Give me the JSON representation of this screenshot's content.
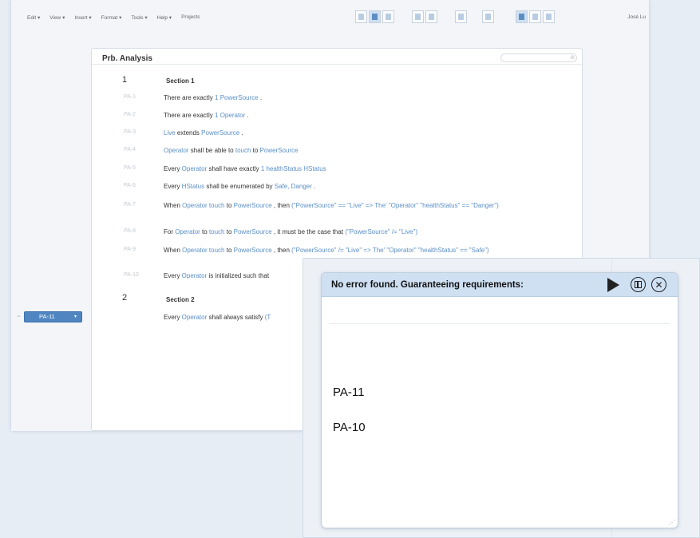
{
  "menu": [
    "Edit",
    "View",
    "Insert",
    "Format",
    "Tools",
    "Help",
    "Projects"
  ],
  "user": "José Lu",
  "doc": {
    "title": "Prb. Analysis",
    "sections": [
      {
        "number": "1",
        "title": "Section 1"
      },
      {
        "number": "2",
        "title": "Section 2"
      }
    ],
    "requirements": [
      {
        "id": "PA-1",
        "segments": [
          [
            "There are exactly ",
            false
          ],
          [
            "1 PowerSource",
            true
          ],
          [
            " .",
            false
          ]
        ]
      },
      {
        "id": "PA-2",
        "segments": [
          [
            "There are exactly ",
            false
          ],
          [
            "1 Operator",
            true
          ],
          [
            " .",
            false
          ]
        ]
      },
      {
        "id": "PA-3",
        "segments": [
          [
            "Live",
            true
          ],
          [
            " extends ",
            false
          ],
          [
            "PowerSource",
            true
          ],
          [
            " .",
            false
          ]
        ]
      },
      {
        "id": "PA-4",
        "segments": [
          [
            "Operator",
            true
          ],
          [
            " shall be able to ",
            false
          ],
          [
            "touch",
            true
          ],
          [
            " to ",
            false
          ],
          [
            "PowerSource",
            true
          ]
        ]
      },
      {
        "id": "PA-5",
        "segments": [
          [
            "Every ",
            false
          ],
          [
            "Operator",
            true
          ],
          [
            " shall have exactly ",
            false
          ],
          [
            "1 healthStatus HStatus",
            true
          ]
        ]
      },
      {
        "id": "PA-6",
        "segments": [
          [
            "Every ",
            false
          ],
          [
            "HStatus",
            true
          ],
          [
            " shall be enumerated by ",
            false
          ],
          [
            "Safe, Danger",
            true
          ],
          [
            " .",
            false
          ]
        ]
      },
      {
        "id": "PA-7",
        "segments": [
          [
            "When ",
            false
          ],
          [
            "Operator touch",
            true
          ],
          [
            " to ",
            false
          ],
          [
            "PowerSource",
            true
          ],
          [
            " , then ",
            false
          ],
          [
            "(\"PowerSource\" == \"Live\" => The' \"Operator\" \"healthStatus\" == \"Danger\")",
            true
          ]
        ]
      },
      {
        "id": "PA-8",
        "segments": [
          [
            "For ",
            false
          ],
          [
            "Operator",
            true
          ],
          [
            " to ",
            false
          ],
          [
            "touch",
            true
          ],
          [
            " to ",
            false
          ],
          [
            "PowerSource",
            true
          ],
          [
            " , it must be the case that ",
            false
          ],
          [
            "(\"PowerSource\" /= \"Live\")",
            true
          ]
        ]
      },
      {
        "id": "PA-9",
        "segments": [
          [
            "When ",
            false
          ],
          [
            "Operator touch",
            true
          ],
          [
            " to ",
            false
          ],
          [
            "PowerSource",
            true
          ],
          [
            " , then ",
            false
          ],
          [
            "(\"PowerSource\" /= \"Live\" => The' \"Operator\" \"healthStatus\" == \"Safe\")",
            true
          ]
        ]
      },
      {
        "id": "PA-10",
        "segments": [
          [
            "Every ",
            false
          ],
          [
            "Operator",
            true
          ],
          [
            " is initialized such that ",
            false
          ]
        ]
      },
      {
        "id": "PA-11",
        "segments": [
          [
            "Every ",
            false
          ],
          [
            "Operator",
            true
          ],
          [
            " shall always satisfy ",
            false
          ],
          [
            "(T",
            true
          ]
        ]
      }
    ]
  },
  "popup": {
    "title": "No error found. Guaranteeing requirements:",
    "items": [
      "PA-11",
      "PA-10"
    ]
  }
}
